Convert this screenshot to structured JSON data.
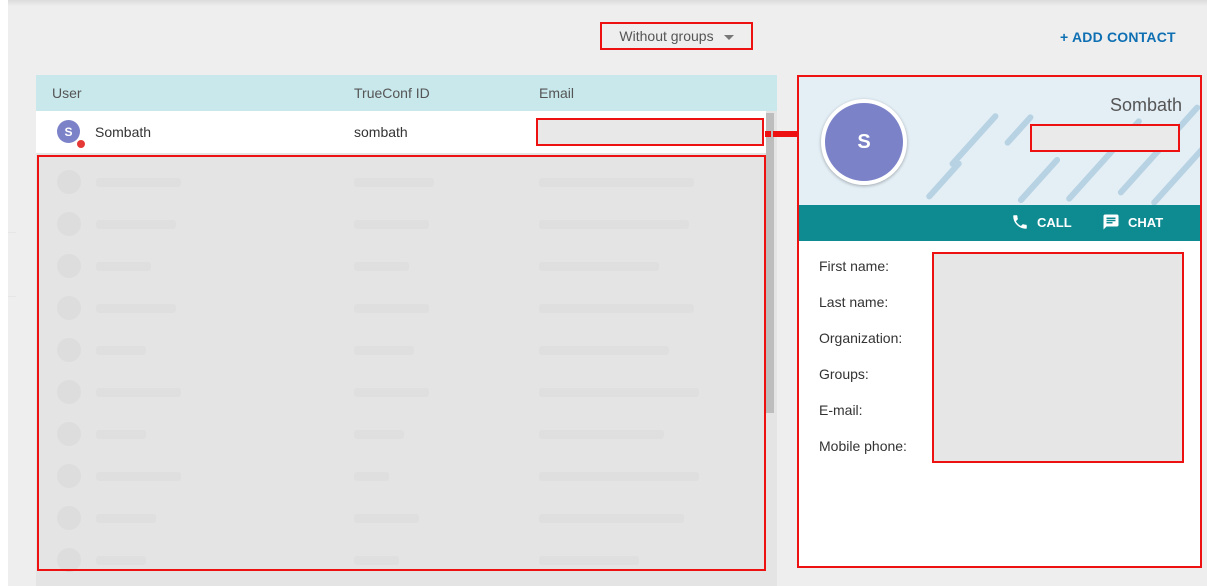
{
  "toolbar": {
    "filter_label": "Without groups",
    "add_contact_label": "+ ADD CONTACT"
  },
  "table": {
    "columns": [
      "User",
      "TrueConf ID",
      "Email"
    ],
    "selected_row": {
      "avatar_initial": "S",
      "name": "Sombath",
      "trueconf_id": "sombath"
    }
  },
  "panel": {
    "display_name": "Sombath",
    "avatar_initial": "S",
    "call_label": "CALL",
    "chat_label": "CHAT",
    "fields": [
      "First name:",
      "Last name:",
      "Organization:",
      "Groups:",
      "E-mail:",
      "Mobile phone:"
    ]
  },
  "colors": {
    "accent": "#0e8a91",
    "header_bg": "#c8e8ec",
    "avatar": "#7b82c8",
    "link": "#0e6fb3",
    "status": "#e53935",
    "redaction_border": "#ee1111"
  },
  "icons": {
    "filter_caret": "caret-down",
    "call": "phone",
    "chat": "message",
    "pointer": "arrow-right"
  }
}
